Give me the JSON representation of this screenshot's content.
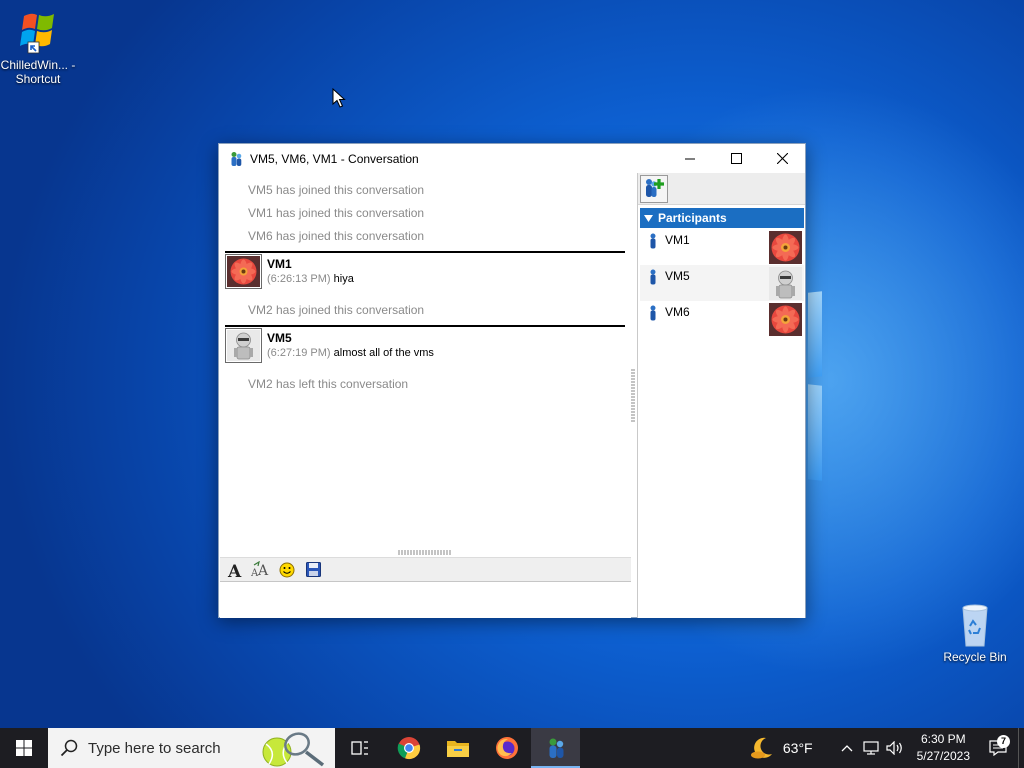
{
  "desktop": {
    "icons": [
      {
        "label": "ChilledWin... - Shortcut",
        "icon": "windows-flag-shortcut-icon"
      },
      {
        "label": "Recycle Bin",
        "icon": "recycle-bin-icon"
      }
    ]
  },
  "window": {
    "title": "VM5, VM6, VM1 - Conversation",
    "controls": {
      "minimize": "minimize-icon",
      "maximize": "maximize-icon",
      "close": "close-icon"
    }
  },
  "chat": {
    "system_messages": [
      "VM5 has joined this conversation",
      "VM1 has joined this conversation",
      "VM6 has joined this conversation",
      "VM2 has joined this conversation",
      "VM2 has left this conversation"
    ],
    "messages": [
      {
        "sender": "VM1",
        "time": "(6:26:13 PM)",
        "text": "hiya",
        "avatar": "flower-avatar"
      },
      {
        "sender": "VM5",
        "time": "(6:27:19 PM)",
        "text": "almost all of the vms",
        "avatar": "robot-avatar"
      }
    ]
  },
  "compose_toolbar": {
    "font": "font-icon",
    "font_size": "font-size-icon",
    "emoticon": "smiley-icon",
    "save": "save-icon"
  },
  "participants": {
    "header": "Participants",
    "items": [
      {
        "name": "VM1",
        "avatar": "flower-avatar"
      },
      {
        "name": "VM5",
        "avatar": "robot-avatar"
      },
      {
        "name": "VM6",
        "avatar": "flower-avatar"
      }
    ]
  },
  "taskbar": {
    "search_placeholder": "Type here to search",
    "apps": [
      "task-view-icon",
      "chrome-icon",
      "file-explorer-icon",
      "firefox-icon",
      "messenger-icon"
    ],
    "weather": "63°F",
    "time": "6:30 PM",
    "date": "5/27/2023",
    "notification_count": "7"
  },
  "colors": {
    "participants_header": "#1b6ec2",
    "system_text": "#8a8a8a",
    "taskbar": "#1d1d22"
  }
}
